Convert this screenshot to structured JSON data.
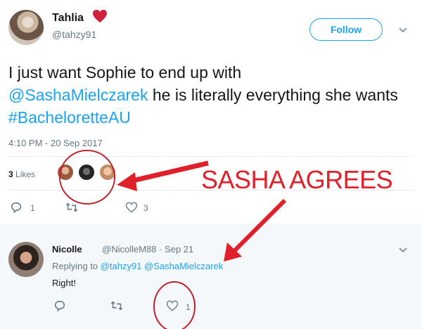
{
  "tweet": {
    "author_name": "Tahlia",
    "author_handle": "@tahzy91",
    "follow_label": "Follow",
    "text_plain_1": "I just want Sophie to end up with",
    "mention": "@SashaMielczarek",
    "text_plain_2": " he is literally everything she wants ",
    "hashtag": "#BacheloretteAU",
    "timestamp": "4:10 PM - 20 Sep 2017",
    "likes_count": "3",
    "likes_word": "Likes",
    "reply_count": "1",
    "retweet_count": "",
    "like_count": "3"
  },
  "annotation": {
    "label": "SASHA AGREES",
    "color": "#e0202a"
  },
  "reply": {
    "author_name": "Nicolle",
    "author_meta": "@NicolleM88 · Sep 21",
    "replying_prefix": "Replying to",
    "replying_handle_1": "@tahzy91",
    "replying_handle_2": "@SashaMielczarek",
    "text": "Right!",
    "like_count": "1"
  },
  "colors": {
    "link": "#1da1f2",
    "muted": "#657786",
    "heart": "#e0245e"
  },
  "icons": {
    "heart_emoji": "heart-icon",
    "reply": "reply-icon",
    "retweet": "retweet-icon",
    "like": "like-icon",
    "more": "chevron-down-icon"
  }
}
